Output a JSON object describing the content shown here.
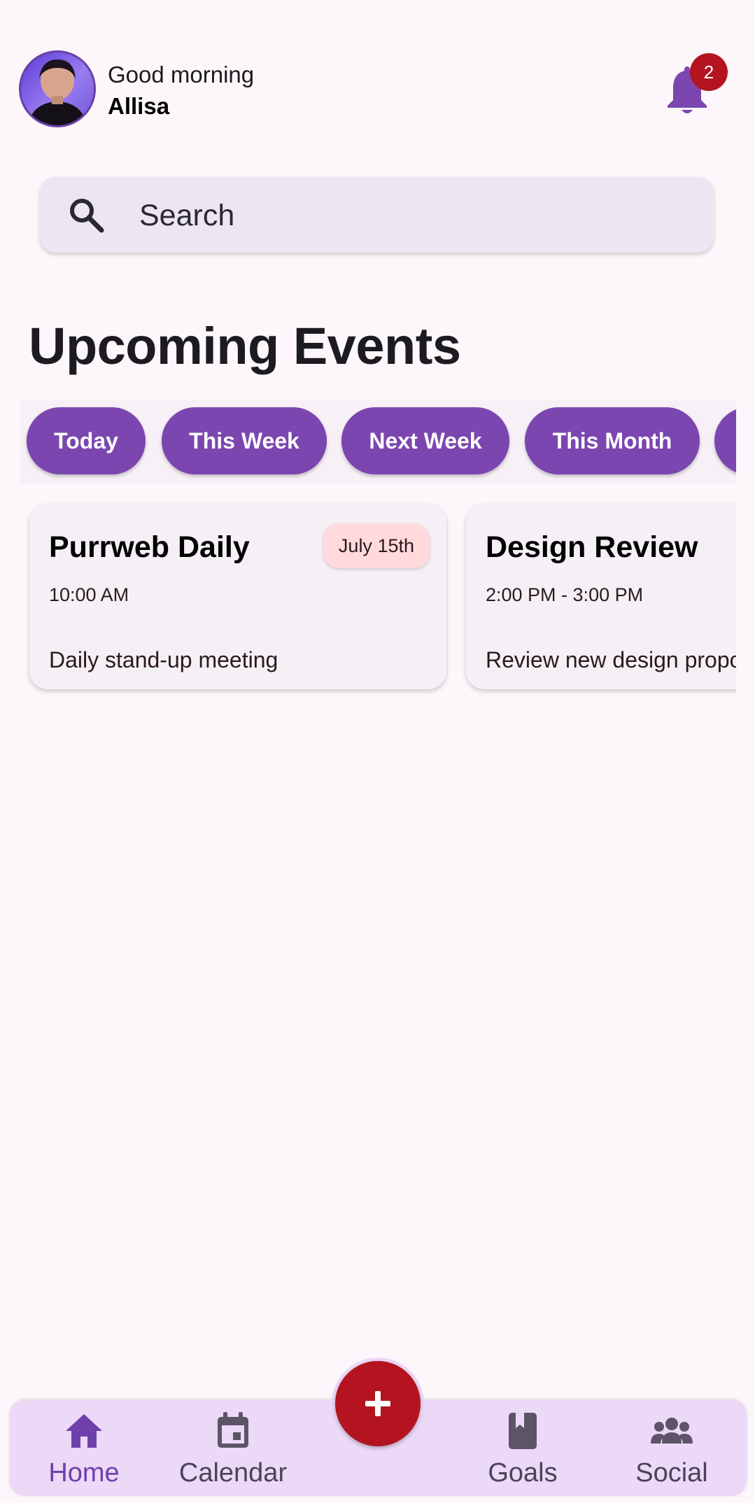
{
  "header": {
    "greeting": "Good morning",
    "username": "Allisa",
    "notification_count": "2"
  },
  "search": {
    "placeholder": "Search"
  },
  "section_title": "Upcoming Events",
  "filters": [
    {
      "label": "Today"
    },
    {
      "label": "This Week"
    },
    {
      "label": "Next Week"
    },
    {
      "label": "This Month"
    },
    {
      "label": ""
    }
  ],
  "events": [
    {
      "title": "Purrweb Daily",
      "time": "10:00 AM",
      "date": "July 15th",
      "description": "Daily stand-up meeting"
    },
    {
      "title": "Design Review",
      "time": "2:00 PM - 3:00 PM",
      "description": "Review new design proposals"
    }
  ],
  "nav": {
    "items": [
      {
        "label": "Home",
        "icon": "home-icon"
      },
      {
        "label": "Calendar",
        "icon": "calendar-icon"
      },
      {
        "label": "Goals",
        "icon": "book-icon"
      },
      {
        "label": "Social",
        "icon": "group-icon"
      }
    ],
    "fab_icon": "plus-icon"
  },
  "colors": {
    "primary": "#7b46b0",
    "accent_red": "#b3141f",
    "nav_background": "#ecd8f7",
    "date_badge": "#ffd9dc"
  }
}
